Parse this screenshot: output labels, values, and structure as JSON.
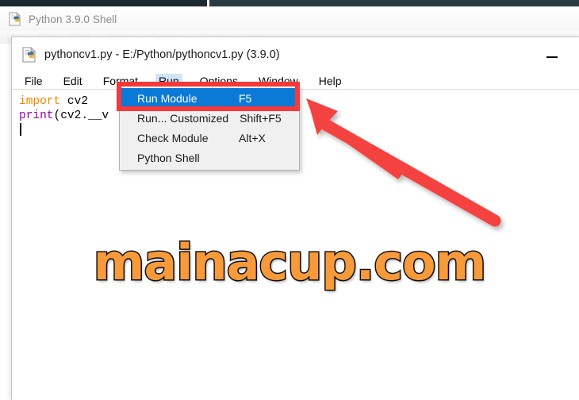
{
  "shell_window": {
    "icon": "python-idle-icon",
    "title": "Python 3.9.0 Shell",
    "menu": [
      {
        "label": "File"
      },
      {
        "label": "Edit"
      },
      {
        "label": "Shell"
      },
      {
        "label": "Debug"
      },
      {
        "label": "Options"
      },
      {
        "label": "Window"
      },
      {
        "label": "Help"
      }
    ]
  },
  "editor_window": {
    "icon": "python-idle-icon",
    "title": "pythoncv1.py - E:/Python/pythoncv1.py (3.9.0)",
    "minimize_label": "—",
    "menu": [
      {
        "label": "File",
        "active": false
      },
      {
        "label": "Edit",
        "active": false
      },
      {
        "label": "Format",
        "active": false
      },
      {
        "label": "Run",
        "active": true
      },
      {
        "label": "Options",
        "active": false
      },
      {
        "label": "Window",
        "active": false
      },
      {
        "label": "Help",
        "active": false
      }
    ],
    "code": {
      "line1_keyword": "import",
      "line1_rest": " cv2",
      "line2_builtin": "print",
      "line2_rest": "(cv2.__v"
    }
  },
  "run_menu": {
    "items": [
      {
        "label": "Run Module",
        "accel": "F5",
        "highlighted": true
      },
      {
        "label": "Run... Customized",
        "accel": "Shift+F5",
        "highlighted": false
      },
      {
        "label": "Check Module",
        "accel": "Alt+X",
        "highlighted": false
      },
      {
        "label": "Python Shell",
        "accel": "",
        "highlighted": false
      }
    ]
  },
  "annotations": {
    "highlight_box_color": "#F9383A",
    "arrow_color": "#F4423F",
    "arrow_name": "red-pointer-arrow"
  },
  "watermark": {
    "text": "mainacup.com",
    "fill_color": "#F79A3C",
    "stroke_color": "#111111"
  }
}
